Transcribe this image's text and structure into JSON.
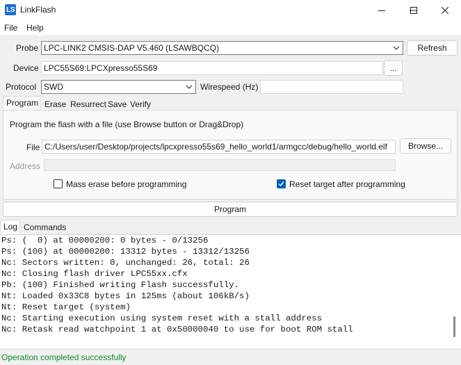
{
  "window": {
    "icon_text": "LS",
    "title": "LinkFlash"
  },
  "menu": {
    "file": "File",
    "help": "Help"
  },
  "probe": {
    "label": "Probe",
    "value": "LPC-LINK2 CMSIS-DAP V5.460 (LSAWBQCQ)",
    "refresh_label": "Refresh"
  },
  "device": {
    "label": "Device",
    "value": "LPC55S69:LPCXpresso55S69",
    "browse_label": "..."
  },
  "protocol": {
    "label": "Protocol",
    "value": "SWD",
    "wirespeed_label": "Wirespeed (Hz)",
    "wirespeed_value": ""
  },
  "tabs": [
    "Program",
    "Erase",
    "Resurrect",
    "Save",
    "Verify"
  ],
  "program_panel": {
    "hint": "Program the flash with a file (use Browse button or Drag&Drop)",
    "file_label": "File",
    "file_value": "C:/Users/user/Desktop/projects/lpcxpresso55s69_hello_world1/armgcc/debug/hello_world.elf",
    "browse_label": "Browse...",
    "address_label": "Address",
    "address_value": "",
    "mass_erase_label": "Mass erase before programming",
    "mass_erase_checked": false,
    "reset_target_label": "Reset target after programming",
    "reset_target_checked": true
  },
  "program_button": "Program",
  "log_tabs": [
    "Log",
    "Commands"
  ],
  "log_lines": [
    "Ps: (  0) at 00000200: 0 bytes - 0/13256",
    "Ps: (100) at 00000200: 13312 bytes - 13312/13256",
    "Nc: Sectors written: 0, unchanged: 26, total: 26",
    "Nc: Closing flash driver LPC55xx.cfx",
    "Pb: (100) Finished writing Flash successfully.",
    "Nt: Loaded 0x33C8 bytes in 125ms (about 106kB/s)",
    "Nt: Reset target (system)",
    "Nc: Starting execution using system reset with a stall address",
    "Nc: Retask read watchpoint 1 at 0x50000040 to use for boot ROM stall"
  ],
  "status": "Operation completed successfully",
  "colors": {
    "accent": "#005fb8",
    "status_text": "#0f8a2e",
    "app_icon": "#1e6fd1"
  }
}
